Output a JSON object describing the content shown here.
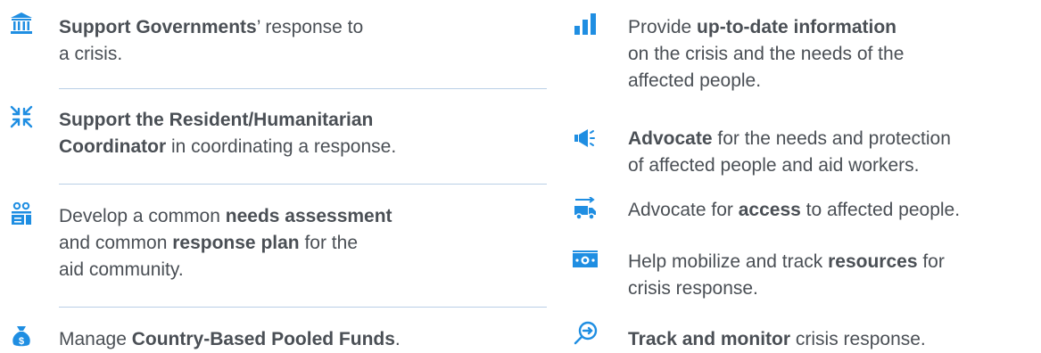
{
  "colors": {
    "accent": "#1f8ee2",
    "text": "#4a4f55",
    "divider": "#b9cfe6"
  },
  "left": [
    {
      "icon": "government-building-icon",
      "lines": [
        [
          {
            "b": "Support Governments"
          },
          {
            "t": "’ response to"
          }
        ],
        [
          {
            "t": "a crisis."
          }
        ]
      ]
    },
    {
      "icon": "converge-arrows-icon",
      "lines": [
        [
          {
            "b": "Support the Resident/Humanitarian"
          }
        ],
        [
          {
            "b": "Coordinator"
          },
          {
            "t": " in coordinating a response."
          }
        ]
      ]
    },
    {
      "icon": "assessment-people-icon",
      "lines": [
        [
          {
            "t": "Develop a common "
          },
          {
            "b": "needs assessment"
          }
        ],
        [
          {
            "t": "and common "
          },
          {
            "b": "response plan"
          },
          {
            "t": " for the"
          }
        ],
        [
          {
            "t": "aid community."
          }
        ]
      ]
    },
    {
      "icon": "money-bag-icon",
      "lines": [
        [
          {
            "t": "Manage "
          },
          {
            "b": "Country-Based Pooled Funds"
          },
          {
            "t": "."
          }
        ]
      ]
    }
  ],
  "right": [
    {
      "icon": "bar-chart-icon",
      "lines": [
        [
          {
            "t": "Provide "
          },
          {
            "b": "up-to-date information"
          }
        ],
        [
          {
            "t": "on the crisis and the needs of the"
          }
        ],
        [
          {
            "t": "affected people."
          }
        ]
      ]
    },
    {
      "icon": "megaphone-icon",
      "lines": [
        [
          {
            "b": "Advocate"
          },
          {
            "t": " for the needs and protection"
          }
        ],
        [
          {
            "t": "of affected people and aid workers."
          }
        ]
      ]
    },
    {
      "icon": "truck-access-icon",
      "lines": [
        [
          {
            "t": "Advocate for "
          },
          {
            "b": "access"
          },
          {
            "t": " to affected people."
          }
        ]
      ]
    },
    {
      "icon": "cash-resources-icon",
      "lines": [
        [
          {
            "t": "Help mobilize and track "
          },
          {
            "b": "resources"
          },
          {
            "t": " for"
          }
        ],
        [
          {
            "t": "crisis response."
          }
        ]
      ]
    },
    {
      "icon": "search-monitor-icon",
      "lines": [
        [
          {
            "b": "Track and monitor"
          },
          {
            "t": " crisis response."
          }
        ]
      ]
    }
  ]
}
